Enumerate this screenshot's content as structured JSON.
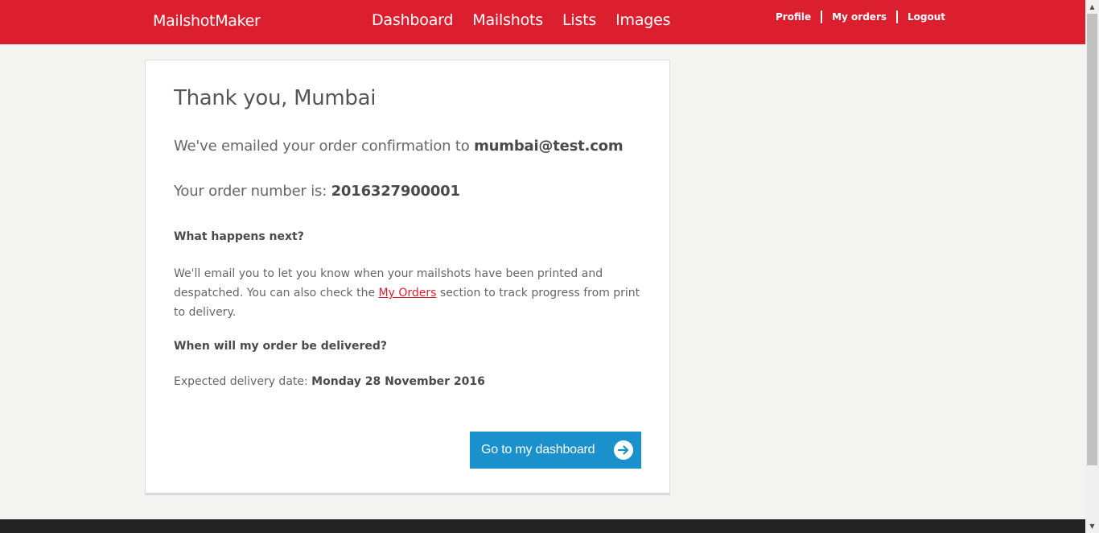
{
  "header": {
    "brand": "MailshotMaker",
    "nav": [
      "Dashboard",
      "Mailshots",
      "Lists",
      "Images"
    ],
    "user_nav": [
      "Profile",
      "My orders",
      "Logout"
    ]
  },
  "confirmation": {
    "title": "Thank you, Mumbai",
    "email_prefix": "We've emailed your order confirmation to ",
    "email": "mumbai@test.com",
    "order_prefix": "Your order number is: ",
    "order_number": "2016327900001",
    "next_heading": "What happens next?",
    "next_text_before": "We'll email you to let  you know when your mailshots have been printed and despatched. You can also check the ",
    "next_link": "My Orders",
    "next_text_after": " section to track progress from print to delivery.",
    "when_heading": "When will my order be delivered?",
    "delivery_prefix": "Expected delivery date: ",
    "delivery_date": "Monday 28 November 2016",
    "button_label": "Go to my dashboard"
  },
  "colors": {
    "header_red": "#dc1f2f",
    "button_blue": "#1a90cc",
    "link_red": "#dc1f2f",
    "footer_dark": "#232323"
  },
  "icons": {
    "button_icon": "arrow-right-circle-icon",
    "scroll_up": "triangle-up-icon",
    "scroll_down": "triangle-down-icon"
  }
}
